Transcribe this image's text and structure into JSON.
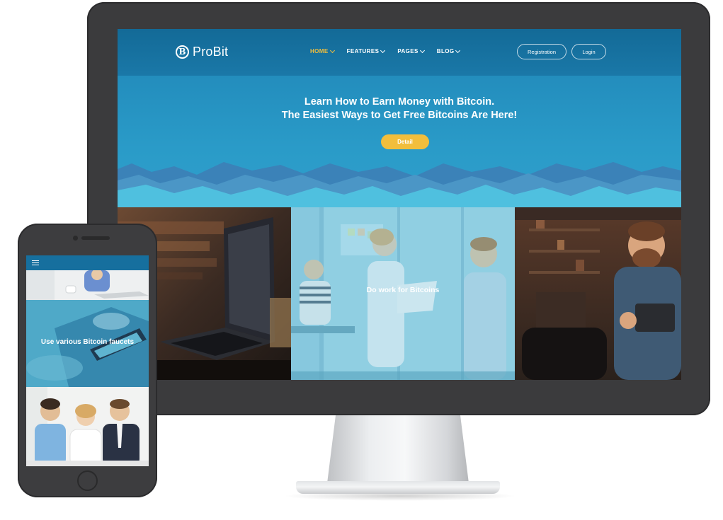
{
  "site": {
    "logo_mark": "B",
    "logo_text": "ProBit",
    "nav": [
      {
        "label": "HOME",
        "active": true
      },
      {
        "label": "FEATURES",
        "active": false
      },
      {
        "label": "PAGES",
        "active": false
      },
      {
        "label": "BLOG",
        "active": false
      }
    ],
    "registration_label": "Registration",
    "login_label": "Login"
  },
  "hero": {
    "line1": "Learn How to Earn Money with Bitcoin.",
    "line2": "The Easiest Ways to Get Free Bitcoins Are Here!",
    "button_label": "Detail"
  },
  "tiles": {
    "middle_caption": "Do work for Bitcoins"
  },
  "phone": {
    "caption": "Use various Bitcoin faucets"
  },
  "colors": {
    "accent": "#f2be3c",
    "header_blue": "#136a97",
    "hero_blue": "#2a9bc8",
    "device_frame": "#3b3b3d"
  },
  "icons": [
    "bitcoin-logo-icon",
    "chevron-down-icon",
    "hamburger-menu-icon"
  ]
}
